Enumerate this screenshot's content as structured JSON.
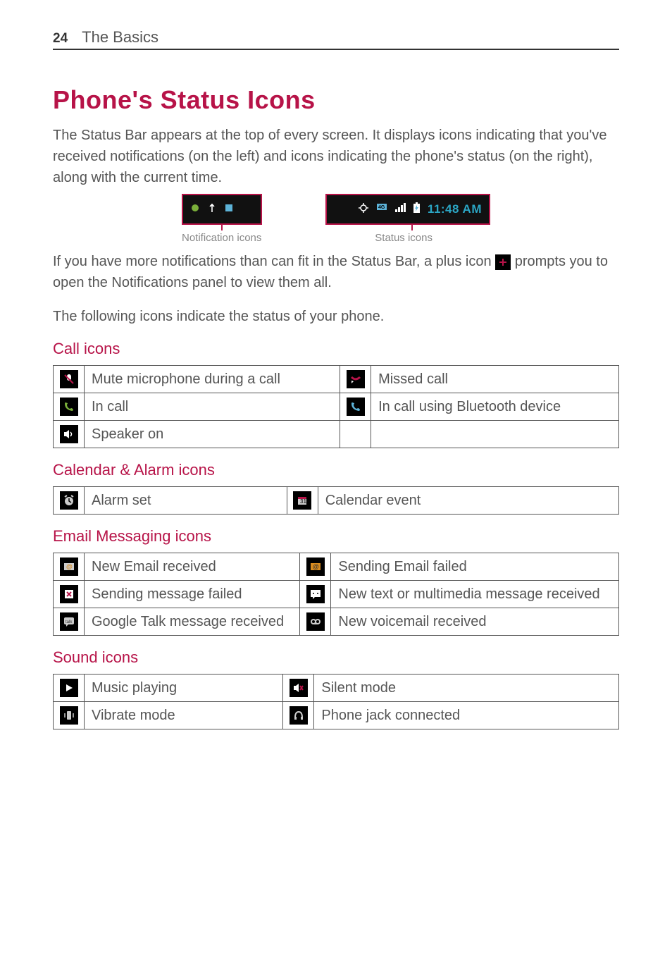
{
  "page": {
    "number": "24",
    "section": "The Basics"
  },
  "heading": "Phone's Status Icons",
  "intro_text": "The Status Bar appears at the top of every screen. It displays icons indicating that you've received notifications (on the left) and icons indicating the phone's status (on the right), along with the current time.",
  "statusbar": {
    "left_label": "Notification icons",
    "right_label": "Status icons",
    "time": "11:48 AM"
  },
  "plus_para_a": "If you have more notifications than can fit in the Status Bar, a plus icon ",
  "plus_para_b": " prompts you to open the Notifications panel to view them all.",
  "following_text": "The following icons indicate the status of your phone.",
  "groups": {
    "call": {
      "title": "Call icons",
      "items": {
        "mute": "Mute microphone during a call",
        "missed": "Missed call",
        "incall": "In call",
        "bt": "In call using Bluetooth device",
        "speaker": "Speaker on"
      }
    },
    "calalarm": {
      "title": "Calendar & Alarm icons",
      "items": {
        "alarm": "Alarm set",
        "calendar": "Calendar event"
      }
    },
    "email": {
      "title": "Email Messaging icons",
      "items": {
        "new_email": "New Email received",
        "send_email_fail": "Sending Email failed",
        "send_msg_fail": "Sending message failed",
        "new_mms": "New text or multimedia message received",
        "gtalk": "Google Talk message received",
        "voicemail": "New voicemail received"
      }
    },
    "sound": {
      "title": "Sound icons",
      "items": {
        "music": "Music playing",
        "silent": "Silent mode",
        "vibrate": "Vibrate mode",
        "jack": "Phone jack connected"
      }
    }
  }
}
